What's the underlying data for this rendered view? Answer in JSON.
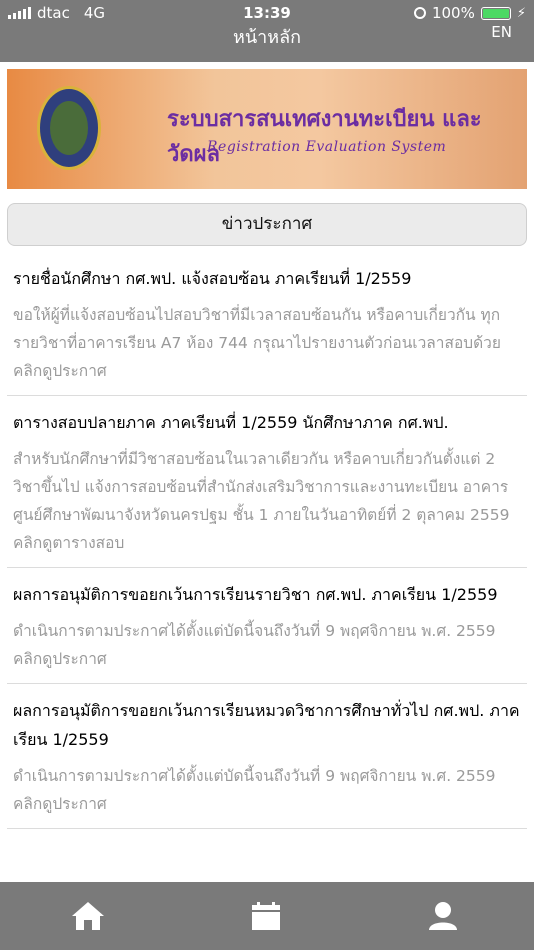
{
  "status": {
    "carrier": "dtac",
    "network": "4G",
    "time": "13:39",
    "battery": "100%"
  },
  "header": {
    "title": "หน้าหลัก",
    "lang": "EN"
  },
  "banner": {
    "title": "ระบบสารสนเทศงานทะเบียน และวัดผล",
    "subtitle": "Registration Evaluation System"
  },
  "news_button": {
    "label": "ข่าวประกาศ"
  },
  "news": [
    {
      "title": "รายชื่อนักศึกษา กศ.พป. แจ้งสอบซ้อน ภาคเรียนที่ 1/2559",
      "desc": "ขอให้ผู้ที่แจ้งสอบซ้อนไปสอบวิชาที่มีเวลาสอบซ้อนกัน หรือคาบเกี่ยวกัน ทุกรายวิชาที่อาคารเรียน A7 ห้อง 744 กรุณาไปรายงานตัวก่อนเวลาสอบด้วย คลิกดูประกาศ"
    },
    {
      "title": "ตารางสอบปลายภาค ภาคเรียนที่ 1/2559 นักศึกษาภาค กศ.พป.",
      "desc": "สำหรับนักศึกษาที่มีวิชาสอบซ้อนในเวลาเดียวกัน หรือคาบเกี่ยวกันตั้งแต่ 2 วิชาขึ้นไป แจ้งการสอบซ้อนที่สำนักส่งเสริมวิชาการและงานทะเบียน อาคารศูนย์ศึกษาพัฒนาจังหวัดนครปฐม ชั้น 1 ภายในวันอาทิตย์ที่ 2 ตุลาคม 2559 คลิกดูตารางสอบ"
    },
    {
      "title": "ผลการอนุมัติการขอยกเว้นการเรียนรายวิชา กศ.พป. ภาคเรียน 1/2559",
      "desc": "ดำเนินการตามประกาศได้ตั้งแต่บัดนี้จนถึงวันที่ 9 พฤศจิกายน พ.ศ. 2559 คลิกดูประกาศ"
    },
    {
      "title": "ผลการอนุมัติการขอยกเว้นการเรียนหมวดวิชาการศึกษาทั่วไป กศ.พป. ภาคเรียน 1/2559",
      "desc": "ดำเนินการตามประกาศได้ตั้งแต่บัดนี้จนถึงวันที่ 9 พฤศจิกายน พ.ศ. 2559 คลิกดูประกาศ"
    }
  ],
  "tabbar": {
    "icons": [
      "home-icon",
      "calendar-icon",
      "user-icon"
    ]
  },
  "colors": {
    "bar": "#7a7a7a",
    "battery": "#4cd964",
    "banner_text": "#6b2da2"
  }
}
